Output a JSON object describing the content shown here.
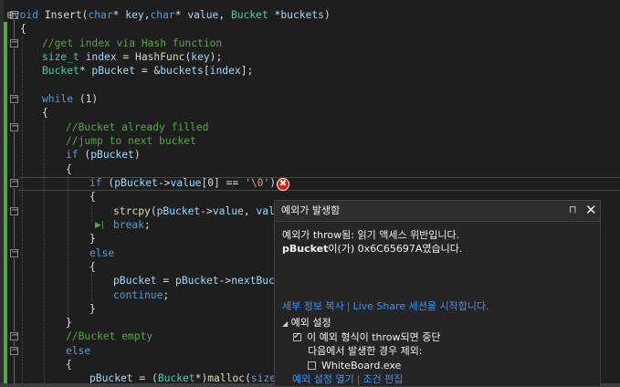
{
  "code_lines": [
    [
      [
        "plain",
        "⊟"
      ],
      [
        "kw",
        "void "
      ],
      [
        "plain",
        "Insert("
      ],
      [
        "kw",
        "char"
      ],
      [
        "plain",
        "* "
      ],
      [
        "var",
        "key"
      ],
      [
        "plain",
        ","
      ],
      [
        "kw",
        "char"
      ],
      [
        "plain",
        "* "
      ],
      [
        "var",
        "value"
      ],
      [
        "plain",
        ", "
      ],
      [
        "type",
        "Bucket "
      ],
      [
        "plain",
        "*"
      ],
      [
        "var",
        "buckets"
      ],
      [
        "plain",
        ")"
      ]
    ],
    [
      [
        "plain",
        "{"
      ]
    ],
    [
      [
        "cm",
        "//get index via Hash function"
      ]
    ],
    [
      [
        "type",
        "size_t "
      ],
      [
        "var",
        "index"
      ],
      [
        "plain",
        " = "
      ],
      [
        "fn",
        "HashFunc"
      ],
      [
        "plain",
        "("
      ],
      [
        "var",
        "key"
      ],
      [
        "plain",
        ");"
      ]
    ],
    [
      [
        "type",
        "Bucket"
      ],
      [
        "plain",
        "* "
      ],
      [
        "var",
        "pBucket"
      ],
      [
        "plain",
        " = &"
      ],
      [
        "var",
        "buckets"
      ],
      [
        "plain",
        "["
      ],
      [
        "var",
        "index"
      ],
      [
        "plain",
        "];"
      ]
    ],
    [],
    [
      [
        "kw",
        "while "
      ],
      [
        "plain",
        "(1)"
      ]
    ],
    [
      [
        "plain",
        "{"
      ]
    ],
    [
      [
        "cm",
        "//Bucket already filled"
      ]
    ],
    [
      [
        "cm",
        "//jump to next bucket"
      ]
    ],
    [
      [
        "kw",
        "if "
      ],
      [
        "plain",
        "("
      ],
      [
        "var",
        "pBucket"
      ],
      [
        "plain",
        ")"
      ]
    ],
    [
      [
        "plain",
        "{"
      ]
    ],
    [
      [
        "kw",
        "if "
      ],
      [
        "plain",
        "("
      ],
      [
        "var",
        "pBucket"
      ],
      [
        "plain",
        "->"
      ],
      [
        "var",
        "value"
      ],
      [
        "plain",
        "[0] == "
      ],
      [
        "str",
        "'\\0'"
      ],
      [
        "plain",
        ")"
      ]
    ],
    [
      [
        "plain",
        "{"
      ]
    ],
    [
      [
        "fn",
        "strcpy"
      ],
      [
        "plain",
        "("
      ],
      [
        "var",
        "pBucket"
      ],
      [
        "plain",
        "->"
      ],
      [
        "var",
        "value"
      ],
      [
        "plain",
        ", "
      ],
      [
        "var",
        "valu"
      ]
    ],
    [
      [
        "kw",
        "break"
      ],
      [
        "plain",
        ";"
      ]
    ],
    [
      [
        "plain",
        "}"
      ]
    ],
    [
      [
        "kw",
        "else"
      ]
    ],
    [
      [
        "plain",
        "{"
      ]
    ],
    [
      [
        "var",
        "pBucket"
      ],
      [
        "plain",
        " = "
      ],
      [
        "var",
        "pBucket"
      ],
      [
        "plain",
        "->"
      ],
      [
        "var",
        "nextBuck"
      ]
    ],
    [
      [
        "kw",
        "continue"
      ],
      [
        "plain",
        ";"
      ]
    ],
    [
      [
        "plain",
        "}"
      ]
    ],
    [
      [
        "plain",
        "}"
      ]
    ],
    [
      [
        "cm",
        "//Bucket empty"
      ]
    ],
    [
      [
        "kw",
        "else"
      ]
    ],
    [
      [
        "plain",
        "{"
      ]
    ],
    [
      [
        "var",
        "pBucket"
      ],
      [
        "plain",
        " = ("
      ],
      [
        "type",
        "Bucket"
      ],
      [
        "plain",
        "*)"
      ],
      [
        "fn",
        "malloc"
      ],
      [
        "plain",
        "("
      ],
      [
        "kw",
        "sizeo"
      ]
    ]
  ],
  "error_glyph": "✖",
  "ip_glyph": "▶|",
  "exception_popup": {
    "title": "예외가 발생함",
    "pin_glyph": "⊓",
    "close_glyph": "✕",
    "message_line1": "예외가 throw됨: 읽기 액세스 위반입니다.",
    "message_var": "pBucket",
    "message_rest": "이(가) 0x6C65697A였습니다.",
    "link_details": "세부 정보 복사",
    "link_separator": "|",
    "link_liveshare": "Live Share 세션을 시작합니다.",
    "settings_header": "예외 설정",
    "settings_triangle": "◢",
    "break_checkbox_label": "이 예외 형식이 throw되면 중단",
    "except_label": "다음에서 발생한 경우 제외:",
    "process_checkbox_label": "WhiteBoard.exe",
    "link_open_settings": "예외 설정 열기",
    "link_edit_conditions": "조건 편집"
  },
  "colors": {
    "keyword": "#569cd6",
    "type": "#4ec9b0",
    "comment": "#57a64a",
    "string": "#d69d85",
    "function": "#dcdcaa",
    "variable": "#9cdcfe",
    "link": "#3794ff",
    "error": "#e51400"
  }
}
